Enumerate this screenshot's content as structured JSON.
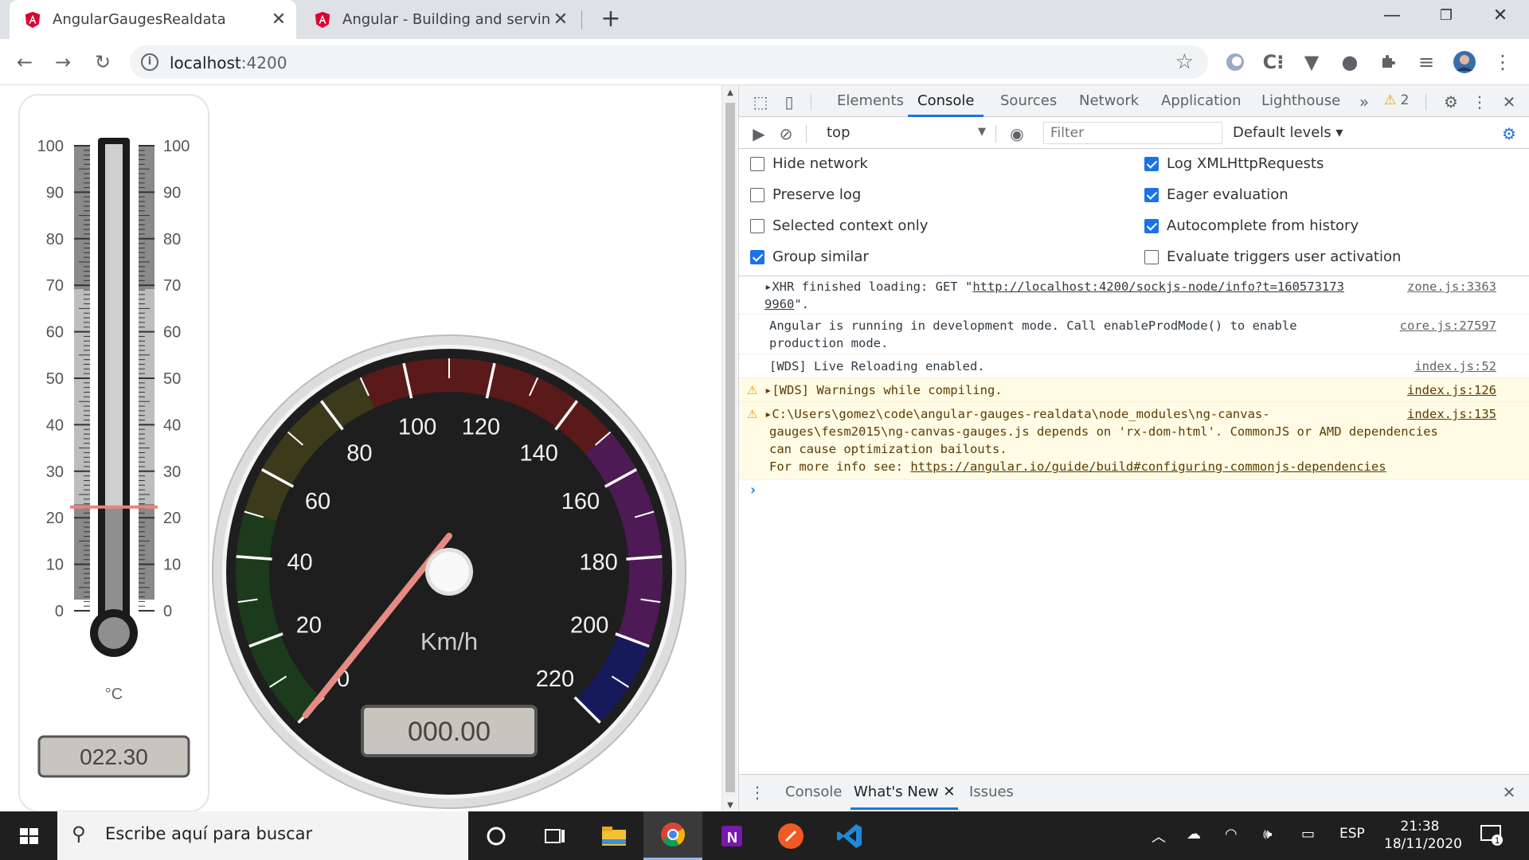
{
  "browser": {
    "tabs": [
      {
        "title": "AngularGaugesRealdata",
        "active": true
      },
      {
        "title": "Angular - Building and serving A",
        "active": false
      }
    ],
    "url_host": "localhost",
    "url_port": ":4200"
  },
  "thermometer": {
    "ticks": [
      "100",
      "90",
      "80",
      "70",
      "60",
      "50",
      "40",
      "30",
      "20",
      "10",
      "0"
    ],
    "unit": "°C",
    "value": 22.3,
    "display": "022.30"
  },
  "speedometer": {
    "ticks": [
      "0",
      "20",
      "40",
      "60",
      "80",
      "100",
      "120",
      "140",
      "160",
      "180",
      "200",
      "220"
    ],
    "unit": "Km/h",
    "value": 0,
    "display": "000.00",
    "zones": [
      {
        "from": 0,
        "to": 50,
        "color": "#1c3a1c"
      },
      {
        "from": 50,
        "to": 90,
        "color": "#3b3a1a"
      },
      {
        "from": 90,
        "to": 150,
        "color": "#5a1a1a"
      },
      {
        "from": 150,
        "to": 200,
        "color": "#4e1a55"
      },
      {
        "from": 200,
        "to": 220,
        "color": "#161a5a"
      }
    ]
  },
  "devtools": {
    "tabs": [
      "Elements",
      "Console",
      "Sources",
      "Network",
      "Application",
      "Lighthouse"
    ],
    "selected_tab": "Console",
    "warning_count": "2",
    "context": "top",
    "filter_placeholder": "Filter",
    "levels": "Default levels",
    "settings": {
      "left": [
        {
          "label": "Hide network",
          "checked": false
        },
        {
          "label": "Preserve log",
          "checked": false
        },
        {
          "label": "Selected context only",
          "checked": false
        },
        {
          "label": "Group similar",
          "checked": true
        }
      ],
      "right": [
        {
          "label": "Log XMLHttpRequests",
          "checked": true
        },
        {
          "label": "Eager evaluation",
          "checked": true
        },
        {
          "label": "Autocomplete from history",
          "checked": true
        },
        {
          "label": "Evaluate triggers user activation",
          "checked": false
        }
      ]
    },
    "messages": [
      {
        "prefix": "XHR finished loading: GET \"",
        "link": "http://localhost:4200/sockjs-node/info?t=160573173",
        "line2_link": "9960",
        "suffix": "\".",
        "source": "zone.js:3363"
      },
      {
        "text1": "Angular is running in development mode. Call enableProdMode() to enable",
        "text2": "production mode.",
        "source": "core.js:27597"
      },
      {
        "text": "[WDS] Live Reloading enabled.",
        "source": "index.js:52"
      },
      {
        "text": "[WDS] Warnings while compiling.",
        "source": "index.js:126"
      },
      {
        "line1": "C:\\Users\\gomez\\code\\angular-gauges-realdata\\node_modules\\ng-canvas-",
        "line2": "gauges\\fesm2015\\ng-canvas-gauges.js depends on 'rx-dom-html'. CommonJS or AMD dependencies",
        "line3": "can cause optimization bailouts.",
        "line4_prefix": "For more info see: ",
        "line4_link": "https://angular.io/guide/build#configuring-commonjs-dependencies",
        "source": "index.js:135"
      }
    ],
    "drawer_tabs": [
      "Console",
      "What's New",
      "Issues"
    ],
    "drawer_selected": "What's New"
  },
  "taskbar": {
    "search_placeholder": "Escribe aquí para buscar",
    "language": "ESP",
    "time": "21:38",
    "date": "18/11/2020",
    "notification_count": "1"
  }
}
